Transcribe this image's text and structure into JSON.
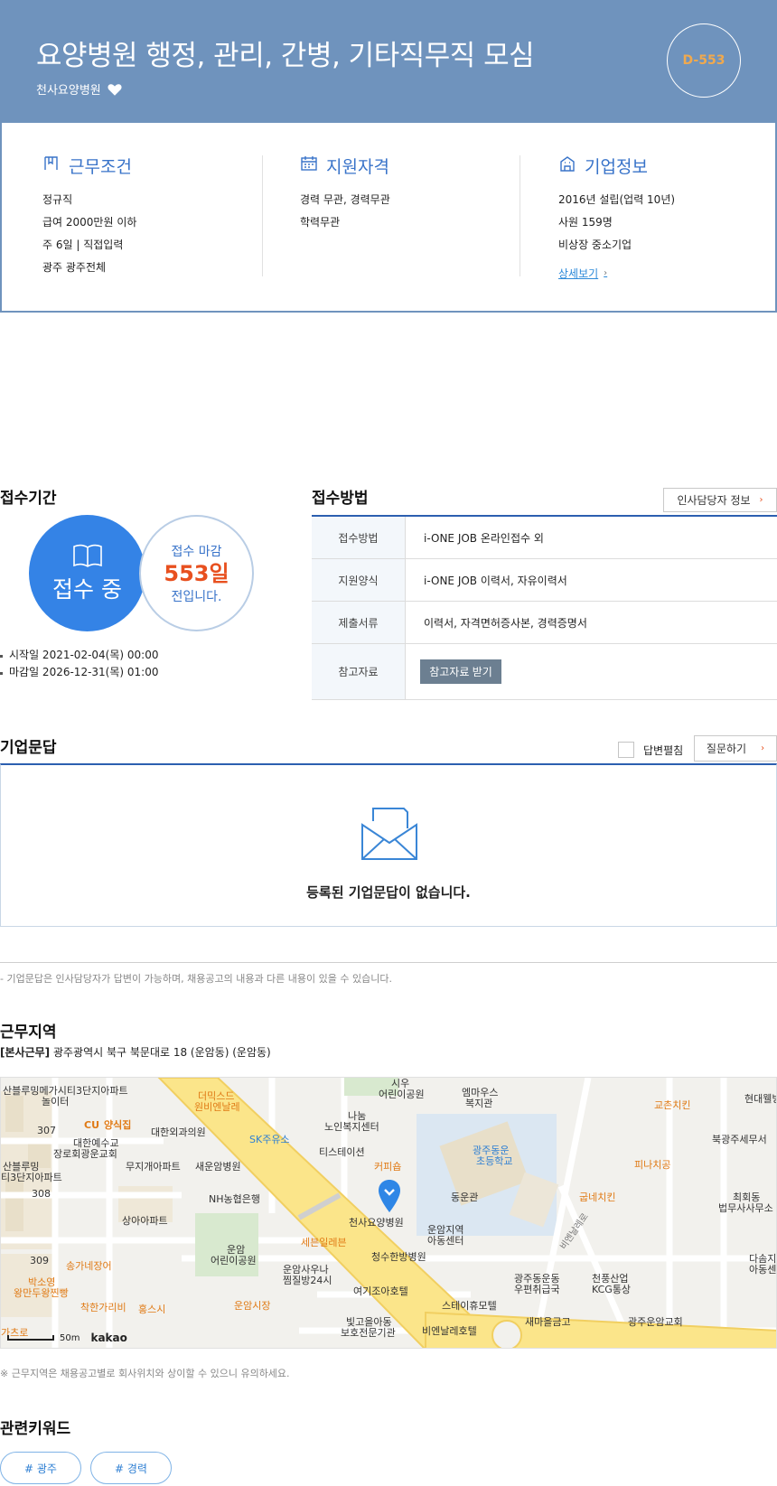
{
  "header": {
    "title": "요양병원 행정, 관리, 간병, 기타직무직 모심",
    "company": "천사요양병원",
    "dday": "D-553"
  },
  "summary": {
    "work": {
      "heading": "근무조건",
      "lines": [
        "정규직",
        "급여 2000만원 이하",
        "주 6일 | 직접입력",
        "광주 광주전체"
      ]
    },
    "qualification": {
      "heading": "지원자격",
      "lines": [
        "경력 무관, 경력무관",
        "학력무관"
      ]
    },
    "company": {
      "heading": "기업정보",
      "lines": [
        "2016년 설립(업력 10년)",
        "사원 159명",
        "비상장 중소기업"
      ],
      "more_link": "상세보기"
    }
  },
  "period": {
    "title": "접수기간",
    "status": "접수 중",
    "deadline_line1": "접수 마감",
    "deadline_days": "553일",
    "deadline_line3": "전입니다.",
    "start": "시작일 2021-02-04(목) 00:00",
    "end": "마감일 2026-12-31(목) 01:00"
  },
  "method": {
    "title": "접수방법",
    "hr_button": "인사담당자 정보",
    "rows": [
      {
        "label": "접수방법",
        "value": "i-ONE JOB 온라인접수 외"
      },
      {
        "label": "지원양식",
        "value": "i-ONE JOB 이력서, 자유이력서"
      },
      {
        "label": "제출서류",
        "value": "이력서, 자격면허증사본, 경력증명서"
      },
      {
        "label": "참고자료",
        "button": "참고자료 받기"
      }
    ]
  },
  "qa": {
    "title": "기업문답",
    "checkbox_label": "답변펼침",
    "ask_button": "질문하기",
    "empty_text": "등록된 기업문답이 없습니다.",
    "note": "- 기업문답은 인사담당자가 답변이 가능하며, 채용공고의 내용과 다른 내용이 있을 수 있습니다."
  },
  "location": {
    "title": "근무지역",
    "tag": "[본사근무]",
    "address": "광주광역시 북구 북문대로 18 (운암동) (운암동)",
    "scale_label": "50m",
    "provider": "kakao",
    "note": "※ 근무지역은 채용공고별로 회사위치와 상이할 수 있으니 유의하세요.",
    "pois": {
      "p1": "산블루밍메가시티3단지아파트",
      "p2": "놀이터",
      "p3": "307",
      "p4": "CU",
      "p5": "양식집",
      "p6": "대한외과의원",
      "p7": "더믹스드",
      "p8": "원비엔날레",
      "p9": "시우",
      "p10": "어린이공원",
      "p11": "엠마우스",
      "p12": "복지관",
      "p13": "교촌치킨",
      "p14": "현대웰빙",
      "p15": "대한예수교",
      "p16": "장로회광운교회",
      "p17": "나눔",
      "p18": "노인복지센터",
      "p19": "SK주유소",
      "p20": "광주동운",
      "p21": "초등학교",
      "p22": "북광주세무서",
      "p23": "산블루밍",
      "p24": "티3단지아파트",
      "p25": "무지개아파트",
      "p26": "새운암병원",
      "p27": "티스테이션",
      "p28": "커피숍",
      "p29": "피나치공",
      "p30": "308",
      "p31": "NH농협은행",
      "p32": "동운관",
      "p33": "굽네치킨",
      "p34": "최회동",
      "p35": "법무사사무소",
      "p36": "상아아파트",
      "p37": "천사요양병원",
      "p38": "운암지역",
      "p39": "아동센터",
      "p40": "비엔날레로",
      "p41": "세븐일레븐",
      "p42": "309",
      "p43": "송가네장어",
      "p44": "운암",
      "p45": "어린이공원",
      "p46": "청수한방병원",
      "p47": "다솜지",
      "p48": "아동센",
      "p49": "박소영",
      "p50": "왕만두왕찐빵",
      "p51": "운암사우나",
      "p52": "찜질방24시",
      "p53": "광주동운동",
      "p54": "우편취급국",
      "p55": "천풍산업",
      "p56": "KCG통상",
      "p57": "착한가리비",
      "p58": "홍스시",
      "p59": "운암시장",
      "p60": "여기조아호텔",
      "p61": "스테이휴모텔",
      "p62": "새마을금고",
      "p63": "광주운암교회",
      "p64": "빛고을아동",
      "p65": "보호전문기관",
      "p66": "비엔날레호텔",
      "p67": "가츠로"
    }
  },
  "keywords": {
    "title": "관련키워드",
    "items": [
      "# 광주",
      "# 경력"
    ]
  },
  "colors": {
    "header_bg": "#6f93bd",
    "accent_blue": "#3483e6",
    "deadline_orange": "#e8501f",
    "dday_text": "#f0a94e"
  }
}
